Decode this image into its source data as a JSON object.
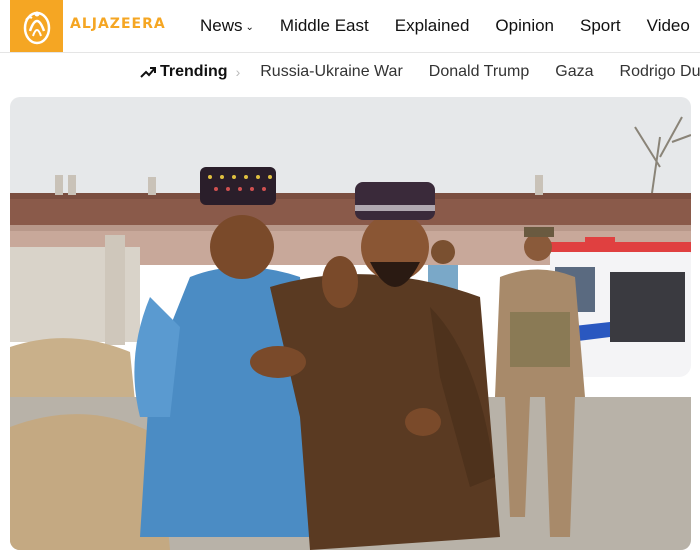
{
  "brand": {
    "name": "ALJAZEERA"
  },
  "nav": {
    "items": [
      {
        "label": "News",
        "has_dropdown": true
      },
      {
        "label": "Middle East"
      },
      {
        "label": "Explained"
      },
      {
        "label": "Opinion"
      },
      {
        "label": "Sport"
      },
      {
        "label": "Video"
      }
    ]
  },
  "trending": {
    "label": "Trending",
    "items": [
      "Russia-Ukraine War",
      "Donald Trump",
      "Gaza",
      "Rodrigo Duterte"
    ]
  },
  "colors": {
    "brand": "#f5a623"
  }
}
